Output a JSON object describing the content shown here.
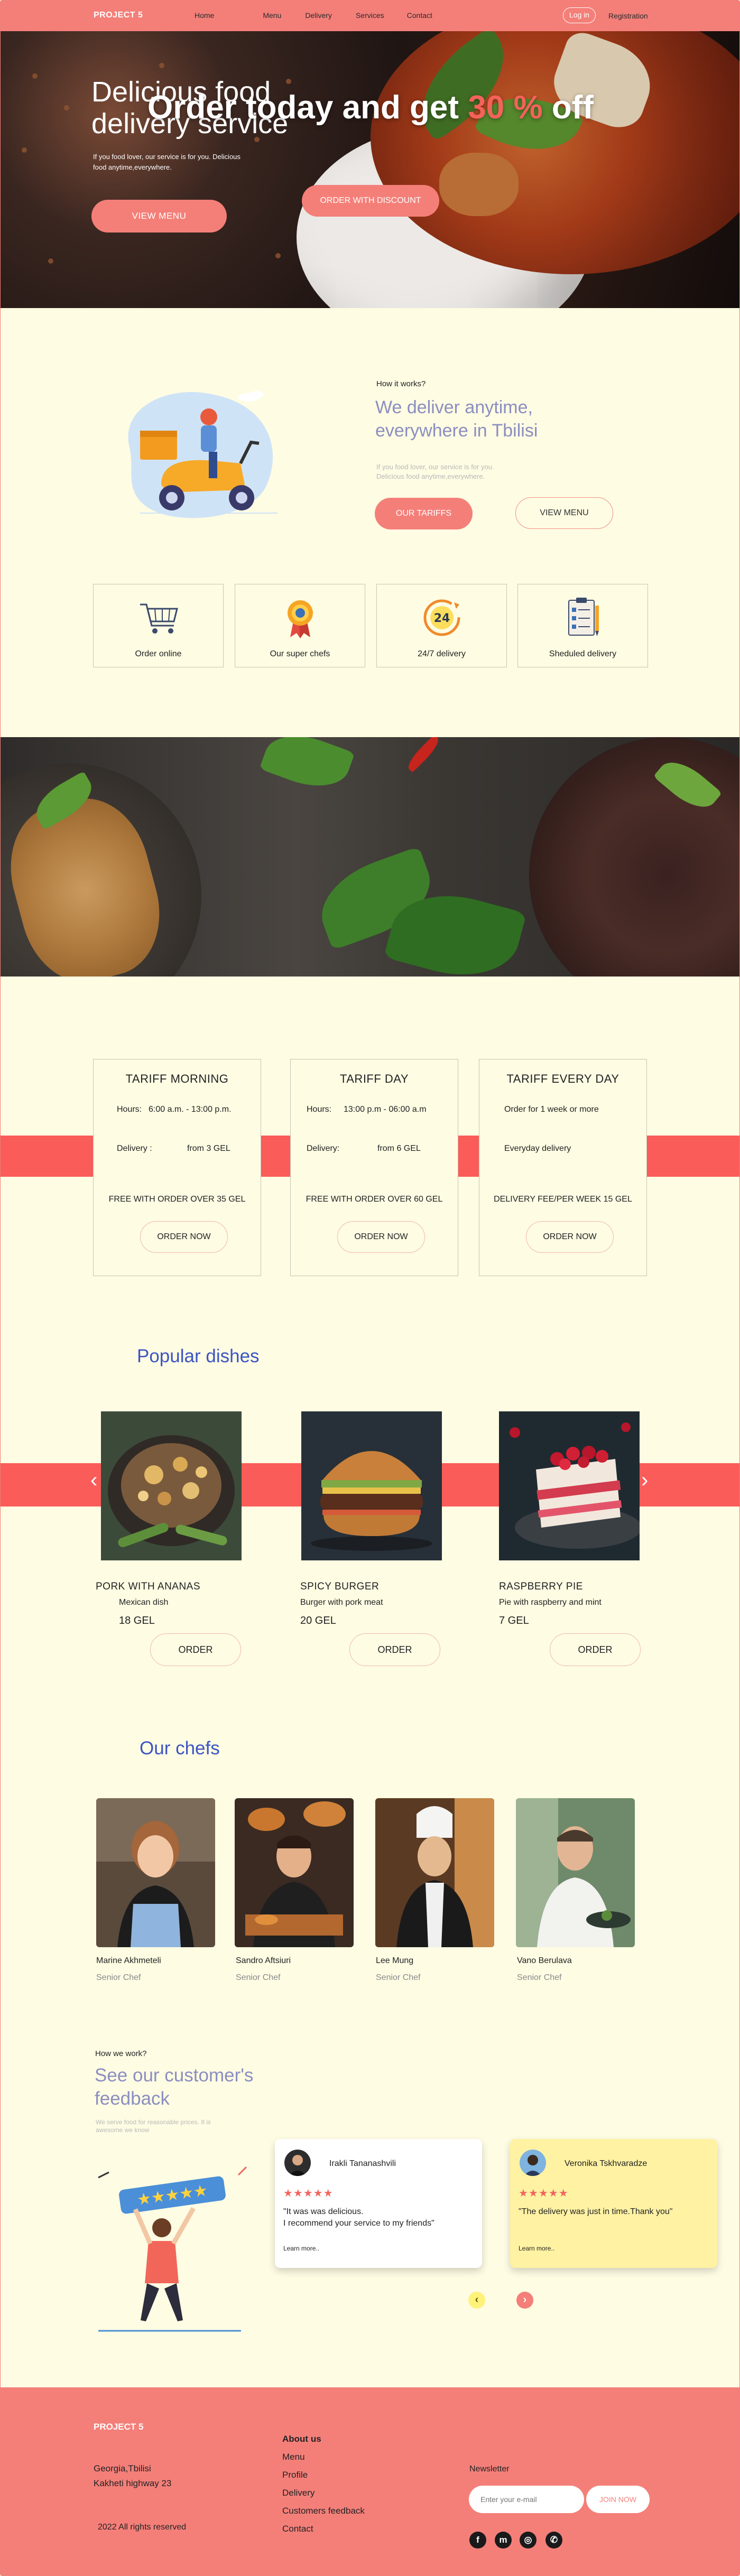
{
  "header": {
    "brand": "PROJECT 5",
    "menu": [
      "Home",
      "Menu",
      "Delivery",
      "Services",
      "Contact"
    ],
    "login": "Log in",
    "registration": "Registration"
  },
  "hero": {
    "title": "Delicious food delivery service",
    "subtitle": "If you food lover, our service is for you. Delicious food anytime,everywhere.",
    "button": "VIEW MENU"
  },
  "how": {
    "label": "How it works?",
    "title": "We deliver anytime, everywhere in Tbilisi",
    "subtitle": "If you food lover, our service is for you. Delicious food anytime,everywhere.",
    "btn_tariffs": "OUR TARIFFS",
    "btn_menu": "VIEW MENU"
  },
  "features": [
    {
      "label": "Order online",
      "icon": "shopping-cart-icon"
    },
    {
      "label": "Our super chefs",
      "icon": "award-medal-icon"
    },
    {
      "label": "24/7 delivery",
      "icon": "clock-24-icon"
    },
    {
      "label": "Sheduled delivery",
      "icon": "clipboard-schedule-icon"
    }
  ],
  "banner": {
    "title_pre": "Order today and get ",
    "title_hl": "30 %",
    "title_post": " off",
    "button": "ORDER WITH DISCOUNT"
  },
  "tariffs": [
    {
      "title": "TARIFF MORNING",
      "row1a": "Hours:",
      "row1b": "6:00 a.m.  - 13:00 p.m.",
      "row2a": "Delivery :",
      "row2b": "from 3 GEL",
      "foot": "FREE WITH ORDER OVER 35 GEL",
      "button": "ORDER NOW"
    },
    {
      "title": "TARIFF  DAY",
      "row1a": "Hours:",
      "row1b": "13:00 p.m - 06:00 a.m",
      "row2a": "Delivery:",
      "row2b": "from 6 GEL",
      "foot": "FREE WITH ORDER OVER 60 GEL",
      "button": "ORDER NOW"
    },
    {
      "title": "TARIFF  EVERY DAY",
      "row1a": "Order  for 1 week or more",
      "row1b": "",
      "row2a": "Everyday delivery",
      "row2b": "",
      "foot": "DELIVERY FEE/PER WEEK 15 GEL",
      "button": "ORDER NOW"
    }
  ],
  "popular": {
    "title": "Popular dishes",
    "arrow_left": "‹",
    "arrow_right": "›",
    "dishes": [
      {
        "name": "PORK WITH ANANAS",
        "desc": "Mexican dish",
        "price": "18 GEL",
        "button": "ORDER"
      },
      {
        "name": "SPICY BURGER",
        "desc": "Burger with pork meat",
        "price": "20 GEL",
        "button": "ORDER"
      },
      {
        "name": "RASPBERRY PIE",
        "desc": "Pie with raspberry and mint",
        "price": "7 GEL",
        "button": "ORDER"
      }
    ]
  },
  "chefs": {
    "title": "Our chefs",
    "list": [
      {
        "name": "Marine Akhmeteli",
        "role": "Senior Chef"
      },
      {
        "name": "Sandro Aftsiuri",
        "role": "Senior Chef"
      },
      {
        "name": "Lee Mung",
        "role": "Senior Chef"
      },
      {
        "name": "Vano Berulava",
        "role": "Senior Chef"
      }
    ]
  },
  "feedback": {
    "label": "How we work?",
    "title": "See our customer's feedback",
    "subtitle": "We serve food for reasonable prices. It is awesome we know",
    "reviews": [
      {
        "name": "Irakli Tananashvili",
        "stars": "★★★★★",
        "quote": "\"It was was delicious.\nI recommend your service to my friends\"",
        "more": "Learn more.."
      },
      {
        "name": "Veronika Tskhvaradze",
        "stars": "★★★★★",
        "quote": "\"The delivery was just in time.Thank you\"",
        "more": "Learn more.."
      }
    ],
    "prev": "‹",
    "next": "›"
  },
  "footer": {
    "brand": "PROJECT 5",
    "address1": "Georgia,Tbilisi",
    "address2": "Kakheti highway 23",
    "copyright": "2022 All rights reserved",
    "links": [
      "About us",
      "Menu",
      "Profile",
      "Delivery",
      "Customers feedback",
      "Contact"
    ],
    "newsletter": "Newsletter",
    "email_placeholder": "Enter your e-mail",
    "join": "JOIN NOW",
    "social": [
      "f",
      "m",
      "◎",
      "✆"
    ]
  },
  "colors": {
    "accent": "#f47f79",
    "stripe": "#fa5c59",
    "background": "#fefce3",
    "link_blue": "#3c54c4",
    "lavender": "#8b8ec0"
  }
}
